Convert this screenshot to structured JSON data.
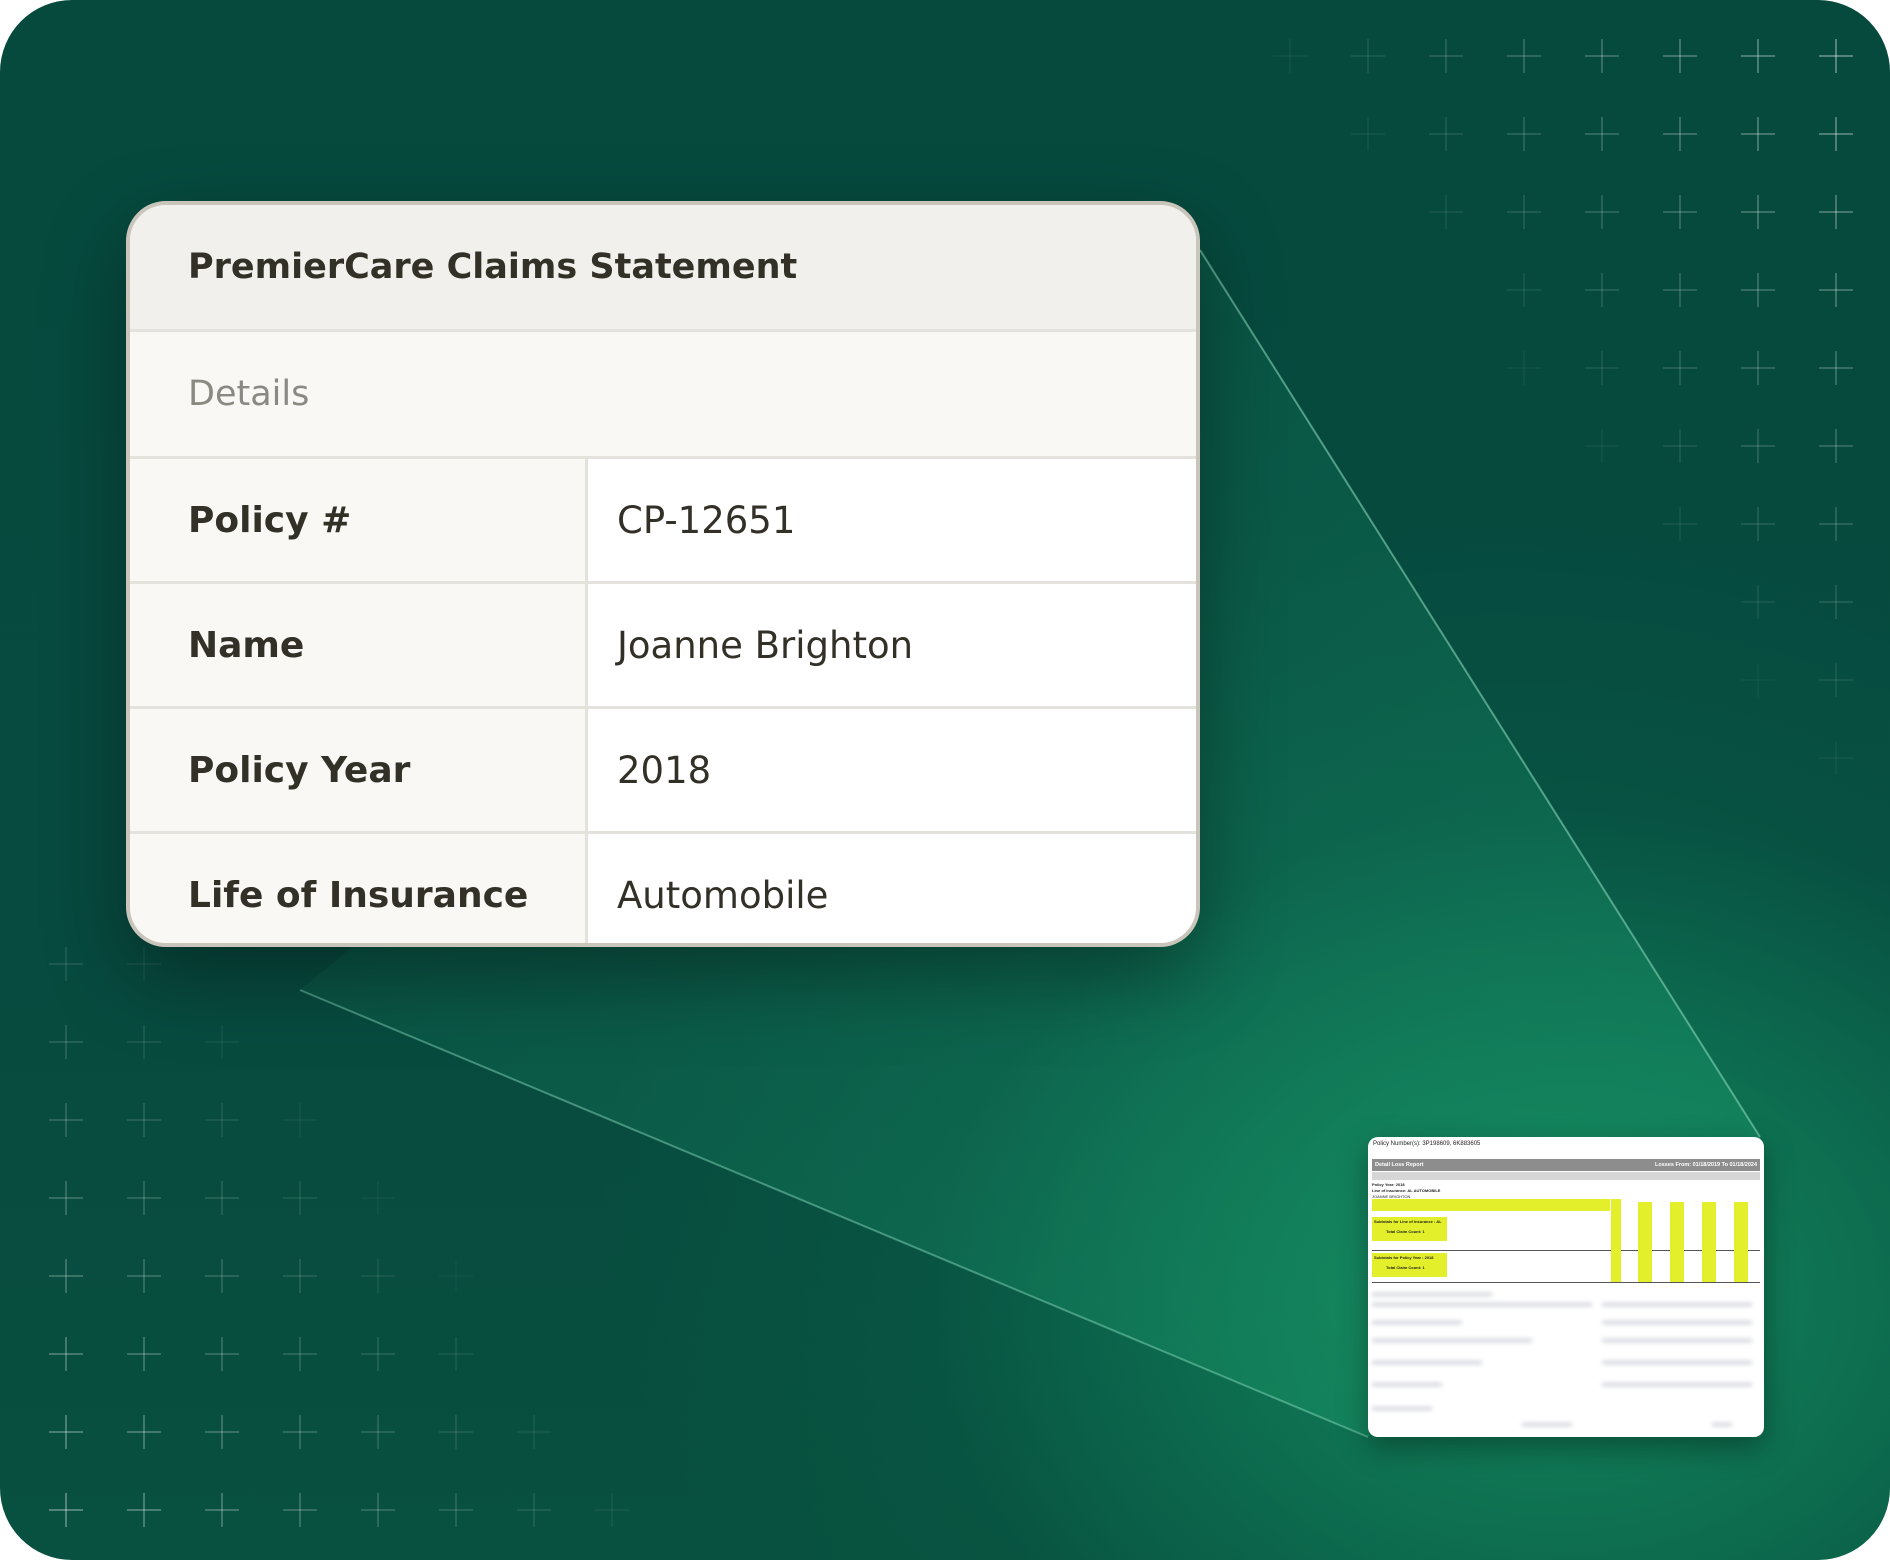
{
  "card": {
    "title": "PremierCare Claims Statement",
    "section": "Details",
    "rows": [
      {
        "label": "Policy #",
        "value": "CP-12651"
      },
      {
        "label": "Name",
        "value": "Joanne Brighton"
      },
      {
        "label": "Policy Year",
        "value": "2018"
      },
      {
        "label": "Life of Insurance",
        "value": "Automobile"
      }
    ]
  },
  "thumbnail": {
    "policy_numbers": "Policy Number(s): 3P198609, 6K883605",
    "report_title": "Detail Loss Report",
    "losses_range": "Losses From: 01/18/2019 To 01/18/2024",
    "policy_year": "Policy Year: 2018",
    "line_of_insurance": "Line of Insurance: AL  AUTOMOBILE",
    "claimant": "JOANNE BRIGHTON",
    "subtotal_line": "Subtotals for Line of Insurance : AL",
    "claim_count_1": "Total Claim Count: 1",
    "subtotal_year": "Subtotals for Policy Year : 2018",
    "claim_count_2": "Total Claim Count: 1"
  },
  "colors": {
    "background": "#064a3e",
    "accent_glow": "#148c5f",
    "card_border": "#c9c5bb",
    "highlight_yellow": "#e2ef2a"
  }
}
